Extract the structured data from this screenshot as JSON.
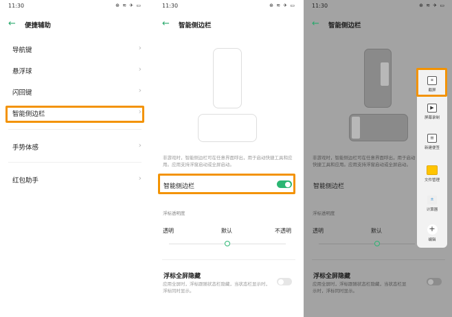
{
  "status": {
    "time": "11:30",
    "icons": "⊕ ≋ ✈ ▭"
  },
  "panel1": {
    "title": "便捷辅助",
    "items": [
      {
        "label": "导航键"
      },
      {
        "label": "悬浮球"
      },
      {
        "label": "闪回键"
      },
      {
        "label": "智能侧边栏"
      },
      {
        "label": "手势体感"
      },
      {
        "label": "红包助手"
      }
    ]
  },
  "sidebar": {
    "title": "智能侧边栏",
    "description": "非游戏时，智能侧边栏可在任意界面呼出，用于启动快捷工具和应用。应用支持浮窗启动或全屏启动。",
    "toggle_label": "智能侧边栏",
    "toggle_on": true,
    "opacity_label": "浮标透明度",
    "opacity_options": {
      "left": "透明",
      "mid": "默认",
      "right": "不透明"
    },
    "opacity_level": 0.5,
    "fullscreen_title": "浮标全屏隐藏",
    "fullscreen_desc": "应用全屏时，浮标跟随状态栏隐藏，当状态栏显示时，浮标同时显示。",
    "fullscreen_on": false
  },
  "tools": [
    {
      "label": "截屏",
      "icon": "crop-icon",
      "glyph": "⌗"
    },
    {
      "label": "屏幕录制",
      "icon": "video-icon",
      "glyph": "▶"
    },
    {
      "label": "新建便签",
      "icon": "note-icon",
      "glyph": "≡"
    },
    {
      "label": "文件管理",
      "icon": "folder-icon",
      "glyph": ""
    },
    {
      "label": "计算器",
      "icon": "calculator-icon",
      "glyph": "±"
    },
    {
      "label": "编辑",
      "icon": "plus-icon",
      "glyph": "+"
    }
  ],
  "colors": {
    "accent": "#2bb673",
    "highlight": "#f39200",
    "dim": "#a3a3a3"
  }
}
